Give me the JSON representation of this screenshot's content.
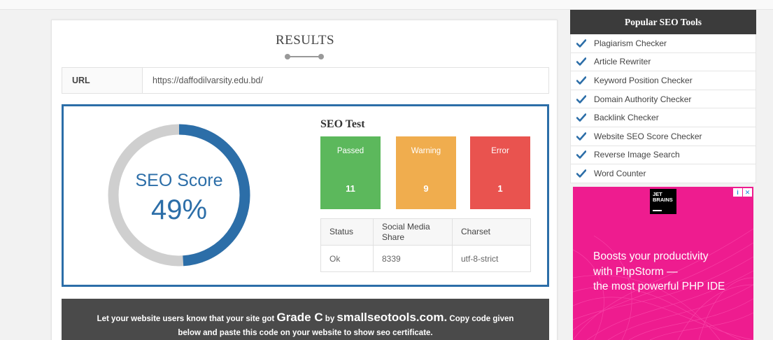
{
  "results": {
    "title": "RESULTS",
    "url_label": "URL",
    "url_value": "https://daffodilvarsity.edu.bd/"
  },
  "score": {
    "label": "SEO Score",
    "value_text": "49%",
    "value": 49,
    "color": "#2c6ea8",
    "track_color": "#cfcfcf"
  },
  "seo_test": {
    "title": "SEO Test",
    "tiles": [
      {
        "label": "Passed",
        "count": "11",
        "color": "#5cb85c"
      },
      {
        "label": "Warning",
        "count": "9",
        "color": "#f0ad4e"
      },
      {
        "label": "Error",
        "count": "1",
        "color": "#e9534f"
      }
    ],
    "table": {
      "headers": [
        "Status",
        "Social Media Share",
        "Charset"
      ],
      "row": [
        "Ok",
        "8339",
        "utf-8-strict"
      ]
    }
  },
  "banner": {
    "part1": "Let your website users know that your site got ",
    "grade": "Grade C",
    "by": " by ",
    "site": "smallseotools.com.",
    "part2": " Copy code given",
    "line2": "below and paste this code on your website to show seo certificate."
  },
  "sidebar": {
    "title": "Popular SEO Tools",
    "check_color": "#2c6ea8",
    "items": [
      {
        "label": "Plagiarism Checker"
      },
      {
        "label": "Article Rewriter"
      },
      {
        "label": "Keyword Position Checker"
      },
      {
        "label": "Domain Authority Checker"
      },
      {
        "label": "Backlink Checker"
      },
      {
        "label": "Website SEO Score Checker"
      },
      {
        "label": "Reverse Image Search"
      },
      {
        "label": "Word Counter"
      }
    ]
  },
  "ad": {
    "logo_line1": "JET",
    "logo_line2": "BRAINS",
    "info_icon": "info-icon",
    "close_icon": "close-icon",
    "line1": "Boosts your productivity",
    "line2": "with PhpStorm —",
    "line3": "the most powerful PHP IDE",
    "bg_color": "#ee1c8f"
  }
}
